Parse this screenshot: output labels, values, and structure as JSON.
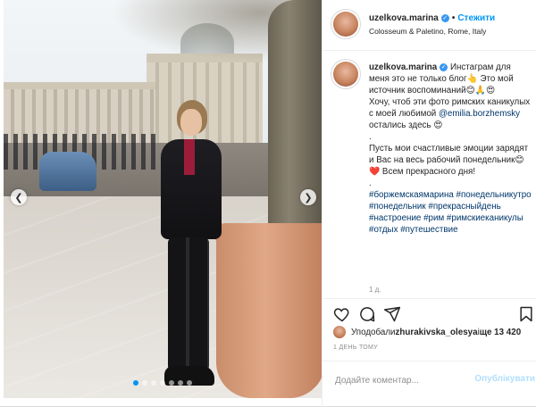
{
  "photo": {
    "slide_count": 7,
    "active_slide": 1
  },
  "header": {
    "username": "uzelkova.marina",
    "separator": "•",
    "follow_label": "Стежити",
    "location": "Colosseum & Paletino, Rome, Italy"
  },
  "caption": {
    "username": "uzelkova.marina",
    "line1": " Инстаграм для меня это не только блог👆 Это мой источник воспоминаний😊🙏😍",
    "line2": "Хочу, чтоб эти фото римских каникулых с моей любимой ",
    "mention": "@emilia.borzhemsky",
    "line3": " остались здесь 😍",
    "dot1": ".",
    "line4": "Пусть мои счастливые эмоции зарядят и Вас на весь рабочий понедельник😊❤️ Всем прекрасного дня!",
    "dot2": ".",
    "hashtags": "#боржемскаямарина #понедельникутро #понедельник #прекрасныйдень #настроение #рим #римскиеканикулы #отдых #путешествие",
    "time": "1 д."
  },
  "likes": {
    "prefix": "Уподобали ",
    "user": "zhurakivska_olesya",
    "middle": " і ",
    "count": "ще 13 420"
  },
  "post_date": "1 ДЕНЬ ТОМУ",
  "comment_box": {
    "placeholder": "Додайте коментар...",
    "publish_label": "Опублікувати"
  },
  "icons": {
    "like": "heart-icon",
    "comment": "comment-icon",
    "share": "share-icon",
    "save": "bookmark-icon",
    "verified": "verified-badge-icon"
  },
  "colors": {
    "link": "#00376b",
    "follow": "#0095f6",
    "publish_disabled": "#b2dffc",
    "muted": "#8e8e8e"
  }
}
